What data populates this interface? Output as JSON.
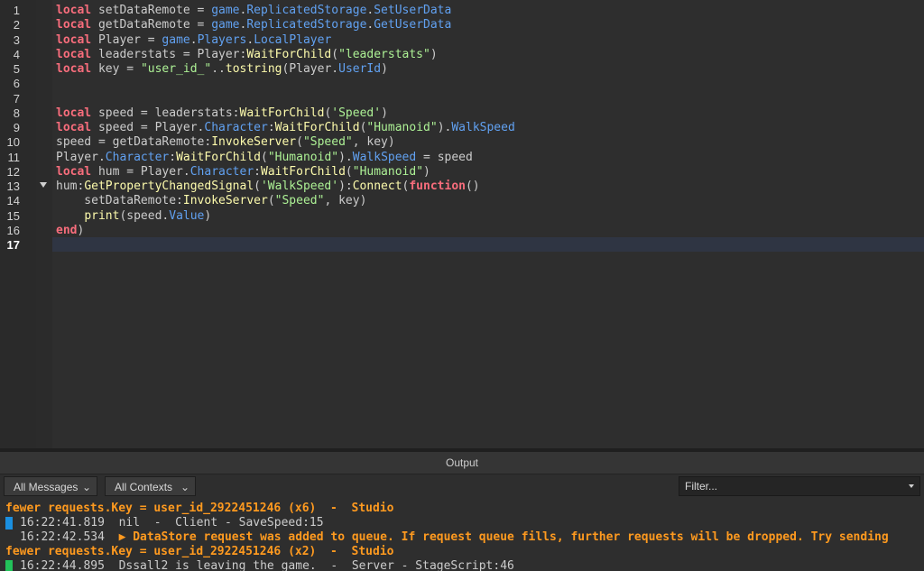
{
  "editor": {
    "current_line": "17",
    "lines": [
      {
        "n": "1",
        "tokens": [
          [
            "k",
            "local"
          ],
          [
            "o",
            " setDataRemote = "
          ],
          [
            "p",
            "game"
          ],
          [
            "o",
            "."
          ],
          [
            "p",
            "ReplicatedStorage"
          ],
          [
            "o",
            "."
          ],
          [
            "p",
            "SetUserData"
          ]
        ]
      },
      {
        "n": "2",
        "tokens": [
          [
            "k",
            "local"
          ],
          [
            "o",
            " getDataRemote = "
          ],
          [
            "p",
            "game"
          ],
          [
            "o",
            "."
          ],
          [
            "p",
            "ReplicatedStorage"
          ],
          [
            "o",
            "."
          ],
          [
            "p",
            "GetUserData"
          ]
        ]
      },
      {
        "n": "3",
        "tokens": [
          [
            "k",
            "local"
          ],
          [
            "o",
            " Player = "
          ],
          [
            "p",
            "game"
          ],
          [
            "o",
            "."
          ],
          [
            "p",
            "Players"
          ],
          [
            "o",
            "."
          ],
          [
            "p",
            "LocalPlayer"
          ]
        ]
      },
      {
        "n": "4",
        "tokens": [
          [
            "k",
            "local"
          ],
          [
            "o",
            " leaderstats = Player:"
          ],
          [
            "f",
            "WaitForChild"
          ],
          [
            "o",
            "("
          ],
          [
            "s",
            "\"leaderstats\""
          ],
          [
            "o",
            ")"
          ]
        ]
      },
      {
        "n": "5",
        "tokens": [
          [
            "k",
            "local"
          ],
          [
            "o",
            " key = "
          ],
          [
            "s",
            "\"user_id_\""
          ],
          [
            "o",
            ".."
          ],
          [
            "f",
            "tostring"
          ],
          [
            "o",
            "(Player."
          ],
          [
            "p",
            "UserId"
          ],
          [
            "o",
            ")"
          ]
        ]
      },
      {
        "n": "6",
        "tokens": []
      },
      {
        "n": "7",
        "tokens": []
      },
      {
        "n": "8",
        "tokens": [
          [
            "k",
            "local"
          ],
          [
            "o",
            " speed = leaderstats:"
          ],
          [
            "f",
            "WaitForChild"
          ],
          [
            "o",
            "("
          ],
          [
            "s",
            "'Speed'"
          ],
          [
            "o",
            ")"
          ]
        ]
      },
      {
        "n": "9",
        "tokens": [
          [
            "k",
            "local"
          ],
          [
            "o",
            " speed = Player."
          ],
          [
            "p",
            "Character"
          ],
          [
            "o",
            ":"
          ],
          [
            "f",
            "WaitForChild"
          ],
          [
            "o",
            "("
          ],
          [
            "s",
            "\"Humanoid\""
          ],
          [
            "o",
            ")."
          ],
          [
            "p",
            "WalkSpeed"
          ]
        ]
      },
      {
        "n": "10",
        "tokens": [
          [
            "o",
            "speed = getDataRemote:"
          ],
          [
            "f",
            "InvokeServer"
          ],
          [
            "o",
            "("
          ],
          [
            "s",
            "\"Speed\""
          ],
          [
            "o",
            ", key)"
          ]
        ]
      },
      {
        "n": "11",
        "tokens": [
          [
            "o",
            "Player."
          ],
          [
            "p",
            "Character"
          ],
          [
            "o",
            ":"
          ],
          [
            "f",
            "WaitForChild"
          ],
          [
            "o",
            "("
          ],
          [
            "s",
            "\"Humanoid\""
          ],
          [
            "o",
            ")."
          ],
          [
            "p",
            "WalkSpeed"
          ],
          [
            "o",
            " = speed"
          ]
        ]
      },
      {
        "n": "12",
        "tokens": [
          [
            "k",
            "local"
          ],
          [
            "o",
            " hum = Player."
          ],
          [
            "p",
            "Character"
          ],
          [
            "o",
            ":"
          ],
          [
            "f",
            "WaitForChild"
          ],
          [
            "o",
            "("
          ],
          [
            "s",
            "\"Humanoid\""
          ],
          [
            "o",
            ")"
          ]
        ]
      },
      {
        "n": "13",
        "tokens": [
          [
            "o",
            "hum:"
          ],
          [
            "f",
            "GetPropertyChangedSignal"
          ],
          [
            "o",
            "("
          ],
          [
            "s",
            "'WalkSpeed'"
          ],
          [
            "o",
            "):"
          ],
          [
            "f",
            "Connect"
          ],
          [
            "o",
            "("
          ],
          [
            "k",
            "function"
          ],
          [
            "o",
            "()"
          ]
        ]
      },
      {
        "n": "14",
        "tokens": [
          [
            "o",
            "    setDataRemote:"
          ],
          [
            "f",
            "InvokeServer"
          ],
          [
            "o",
            "("
          ],
          [
            "s",
            "\"Speed\""
          ],
          [
            "o",
            ", key)"
          ]
        ]
      },
      {
        "n": "15",
        "tokens": [
          [
            "o",
            "    "
          ],
          [
            "f",
            "print"
          ],
          [
            "o",
            "(speed."
          ],
          [
            "p",
            "Value"
          ],
          [
            "o",
            ")"
          ]
        ]
      },
      {
        "n": "16",
        "tokens": [
          [
            "k",
            "end"
          ],
          [
            "o",
            ")"
          ]
        ]
      },
      {
        "n": "17",
        "tokens": []
      }
    ]
  },
  "output": {
    "title": "Output",
    "messages_filter": "All Messages",
    "contexts_filter": "All Contexts",
    "filter_placeholder": "Filter...",
    "logs": [
      {
        "kind": "warn",
        "marker": "",
        "text": "fewer requests.Key = user_id_2922451246 (x6)  -  Studio"
      },
      {
        "kind": "norm",
        "marker": "#1a8fe0",
        "text": "16:22:41.819  nil  -  Client - SaveSpeed:15"
      },
      {
        "kind": "norm",
        "marker": "",
        "prefix": "16:22:42.534  ",
        "warn_text": "▶ DataStore request was added to queue. If request queue fills, further requests will be dropped. Try sending"
      },
      {
        "kind": "warn",
        "marker": "",
        "text": "fewer requests.Key = user_id_2922451246 (x2)  -  Studio"
      },
      {
        "kind": "norm",
        "marker": "#22c25a",
        "text": "16:22:44.895  Dssall2 is leaving the game.  -  Server - StageScript:46"
      }
    ]
  },
  "colors": {
    "keyword": "#f86d7c",
    "function": "#fdfbac",
    "property": "#61a1f1",
    "string": "#adf195",
    "warning": "#ff9a1f"
  }
}
